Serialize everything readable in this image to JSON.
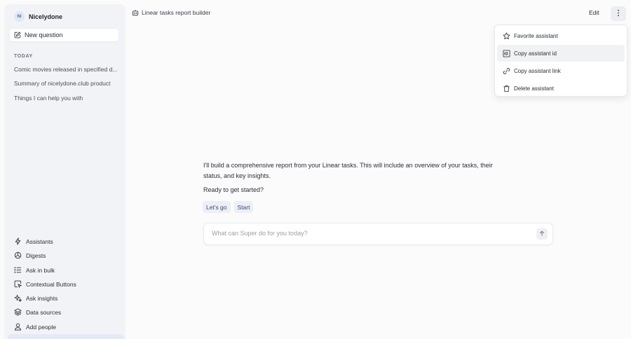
{
  "workspace": {
    "initials": "NI",
    "name": "Nicelydone"
  },
  "sidebar": {
    "new_question": "New question",
    "section_today": "TODAY",
    "history": [
      "Comic movies released in specified d...",
      "Summary of nicelydone.club product",
      "Things I can help you with"
    ],
    "nav": [
      {
        "label": "Assistants",
        "icon": "lightning-icon"
      },
      {
        "label": "Digests",
        "icon": "digest-icon"
      },
      {
        "label": "Ask in bulk",
        "icon": "list-icon"
      },
      {
        "label": "Contextual Buttons",
        "icon": "cursor-box-icon"
      },
      {
        "label": "Ask insights",
        "icon": "sparkle-icon"
      },
      {
        "label": "Data sources",
        "icon": "layers-icon"
      },
      {
        "label": "Add people",
        "icon": "user-icon"
      }
    ]
  },
  "header": {
    "title": "Linear tasks report builder",
    "edit_label": "Edit"
  },
  "menu": {
    "items": [
      {
        "label": "Favorite assistant",
        "icon": "star-icon"
      },
      {
        "label": "Copy assistant id",
        "icon": "id-card-icon"
      },
      {
        "label": "Copy assistant link",
        "icon": "link-icon"
      },
      {
        "label": "Delete assistant",
        "icon": "trash-icon"
      }
    ]
  },
  "chat": {
    "message": "I'll build a comprehensive report from your Linear tasks. This will include an overview of your tasks, their status, and key insights.",
    "prompt": "Ready to get started?",
    "chips": [
      "Let's go",
      "Start"
    ]
  },
  "composer": {
    "placeholder": "What can Super do for you today?",
    "value": ""
  }
}
